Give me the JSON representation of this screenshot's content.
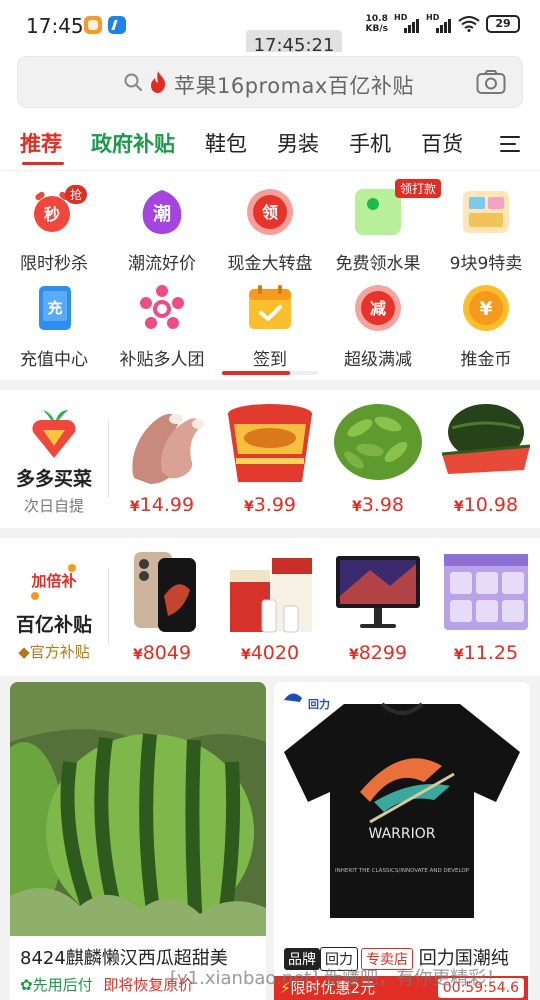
{
  "status_bar": {
    "time": "17:45",
    "net_speed_value": "10.8",
    "net_speed_unit": "KB/s",
    "signal_label": "HD",
    "battery": "29"
  },
  "toast_time": "17:45:21",
  "search": {
    "placeholder": "苹果16promax百亿补贴"
  },
  "tabs": [
    "推荐",
    "政府补贴",
    "鞋包",
    "男装",
    "手机",
    "百货"
  ],
  "categories": [
    {
      "label": "限时秒杀",
      "icon": "alarm-clock-icon",
      "badge": "抢"
    },
    {
      "label": "潮流好价",
      "icon": "trend-icon",
      "glyph": "潮"
    },
    {
      "label": "现金大转盘",
      "icon": "lucky-wheel-icon",
      "glyph": "领"
    },
    {
      "label": "免费领水果",
      "icon": "fruit-icon",
      "badge": "领打款"
    },
    {
      "label": "9块9特卖",
      "icon": "shop-icon"
    },
    {
      "label": "充值中心",
      "icon": "phone-recharge-icon",
      "glyph": "充"
    },
    {
      "label": "补贴多人团",
      "icon": "group-icon"
    },
    {
      "label": "签到",
      "icon": "calendar-check-icon"
    },
    {
      "label": "超级满减",
      "icon": "discount-icon",
      "glyph": "减"
    },
    {
      "label": "推金币",
      "icon": "coin-icon",
      "glyph": "¥"
    }
  ],
  "grocery": {
    "title": "多多买菜",
    "subtitle": "次日自提",
    "currency": "¥",
    "items": [
      {
        "name": "pork-ribs",
        "price": "14.99"
      },
      {
        "name": "instant-noodles",
        "price": "3.99"
      },
      {
        "name": "edamame",
        "price": "3.98"
      },
      {
        "name": "watermelon",
        "price": "10.98"
      }
    ]
  },
  "subsidy": {
    "badge": "加倍补",
    "title": "百亿补贴",
    "subtitle": "官方补贴",
    "currency": "¥",
    "items": [
      {
        "name": "iphone",
        "price": "8049"
      },
      {
        "name": "moutai-liquor",
        "price": "4020"
      },
      {
        "name": "monitor",
        "price": "8299"
      },
      {
        "name": "tissue-pack",
        "price": "11.25"
      }
    ]
  },
  "feed": [
    {
      "title": "8424麒麟懒汉西瓜超甜美",
      "tag_left": "先用后付",
      "tag_right": "即将恢复原价"
    },
    {
      "brand": "品牌",
      "brand_name": "回力",
      "store": "专卖店",
      "title": "回力国潮纯",
      "shirt_text": "WARRIOR",
      "shirt_sub": "INHERIT THE CLASSICS/INNOVATE AND DEVELOP",
      "logo_text": "回力",
      "promo": "限时优惠2元",
      "countdown": "00:59:54.6"
    }
  ],
  "watermark": "[y1.xianbao.net] 新赚吧，有你更精彩！",
  "colors": {
    "accent": "#e02e24",
    "gov_green": "#1a9a4a",
    "gold": "#b07a1c"
  }
}
